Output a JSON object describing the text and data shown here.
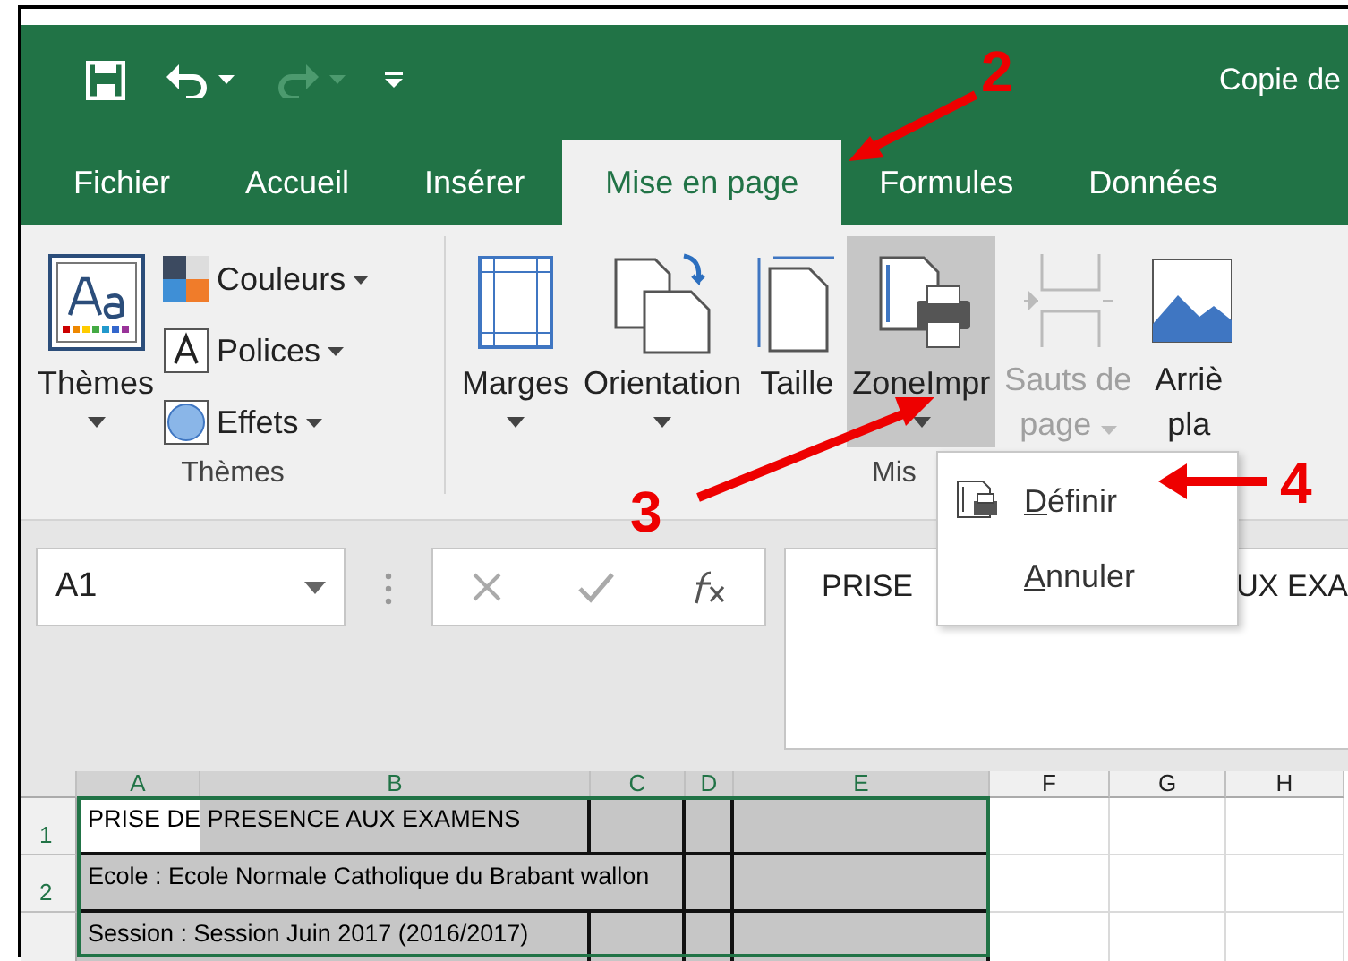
{
  "title_bar": {
    "title": "Copie de"
  },
  "tabs": [
    {
      "label": "Fichier",
      "selected": false
    },
    {
      "label": "Accueil",
      "selected": false
    },
    {
      "label": "Insérer",
      "selected": false
    },
    {
      "label": "Mise en page",
      "selected": true
    },
    {
      "label": "Formules",
      "selected": false
    },
    {
      "label": "Données",
      "selected": false
    }
  ],
  "ribbon": {
    "groups": [
      {
        "label": "Thèmes",
        "buttons": [
          {
            "kind": "large",
            "lines": [
              "Thèmes"
            ],
            "dropdown": true,
            "active": false,
            "disabled": false
          },
          {
            "kind": "stack",
            "items": [
              {
                "label": "Couleurs"
              },
              {
                "label": "Polices"
              },
              {
                "label": "Effets"
              }
            ]
          }
        ]
      },
      {
        "label": "Mis",
        "buttons": [
          {
            "kind": "large",
            "lines": [
              "Marges"
            ],
            "dropdown": true,
            "active": false,
            "disabled": false
          },
          {
            "kind": "large",
            "lines": [
              "Orientation"
            ],
            "dropdown": true,
            "active": false,
            "disabled": false
          },
          {
            "kind": "large",
            "lines": [
              "Taille"
            ],
            "dropdown": false,
            "active": false,
            "disabled": false
          },
          {
            "kind": "large",
            "lines": [
              "ZoneImpr"
            ],
            "dropdown": true,
            "active": true,
            "disabled": false
          },
          {
            "kind": "large",
            "lines": [
              "Sauts de",
              "page"
            ],
            "dropdown": true,
            "active": false,
            "disabled": true
          },
          {
            "kind": "large",
            "lines": [
              "Arriè",
              "pla"
            ],
            "dropdown": false,
            "active": false,
            "disabled": false
          }
        ]
      }
    ]
  },
  "menu": {
    "items": [
      {
        "label": "Définir",
        "icon": true
      },
      {
        "label": "Annuler",
        "icon": false
      }
    ]
  },
  "formula_bar": {
    "name_box": "A1",
    "visible_parts": [
      "PRISE",
      "UX EXA"
    ]
  },
  "sheet": {
    "columns": [
      {
        "label": "A",
        "selected": true
      },
      {
        "label": "B",
        "selected": true
      },
      {
        "label": "C",
        "selected": true
      },
      {
        "label": "D",
        "selected": true
      },
      {
        "label": "E",
        "selected": true
      },
      {
        "label": "F",
        "selected": false
      },
      {
        "label": "G",
        "selected": false
      },
      {
        "label": "H",
        "selected": false
      }
    ],
    "rows": [
      {
        "number": "1",
        "cells": [
          {
            "text": "PRISE DE PRESENCE AUX EXAMENS",
            "active": true
          },
          {
            "active": false
          },
          {
            "active": false
          },
          {
            "active": false
          }
        ]
      },
      {
        "number": "2",
        "cells": [
          {
            "text": "Ecole : Ecole Normale Catholique du Brabant wallon",
            "active": false
          },
          {
            "active": false
          },
          {
            "active": false
          }
        ]
      },
      {
        "cells": [
          {
            "text": "Session : Session Juin 2017 (2016/2017)",
            "active": false
          },
          {
            "active": false
          },
          {
            "active": false
          },
          {
            "active": false
          }
        ]
      }
    ]
  },
  "annotations": [
    {
      "label": "2"
    },
    {
      "label": "3"
    },
    {
      "label": "4"
    }
  ]
}
